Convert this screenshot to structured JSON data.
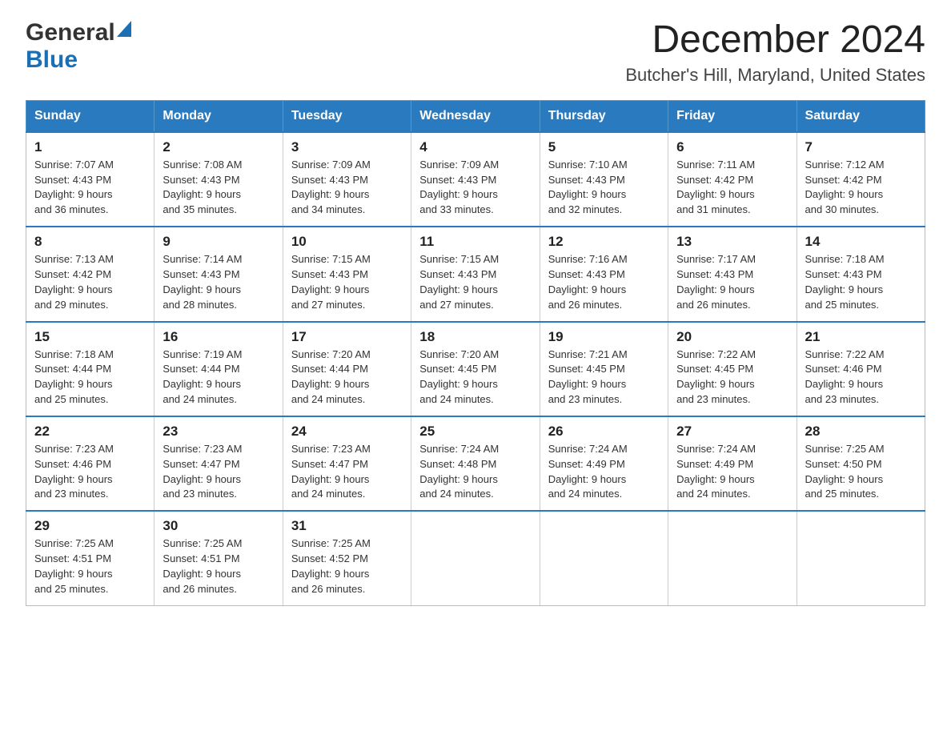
{
  "logo": {
    "general": "General",
    "blue": "Blue"
  },
  "header": {
    "title": "December 2024",
    "subtitle": "Butcher's Hill, Maryland, United States"
  },
  "calendar": {
    "days_of_week": [
      "Sunday",
      "Monday",
      "Tuesday",
      "Wednesday",
      "Thursday",
      "Friday",
      "Saturday"
    ],
    "weeks": [
      [
        {
          "day": "1",
          "sunrise": "7:07 AM",
          "sunset": "4:43 PM",
          "daylight": "9 hours and 36 minutes."
        },
        {
          "day": "2",
          "sunrise": "7:08 AM",
          "sunset": "4:43 PM",
          "daylight": "9 hours and 35 minutes."
        },
        {
          "day": "3",
          "sunrise": "7:09 AM",
          "sunset": "4:43 PM",
          "daylight": "9 hours and 34 minutes."
        },
        {
          "day": "4",
          "sunrise": "7:09 AM",
          "sunset": "4:43 PM",
          "daylight": "9 hours and 33 minutes."
        },
        {
          "day": "5",
          "sunrise": "7:10 AM",
          "sunset": "4:43 PM",
          "daylight": "9 hours and 32 minutes."
        },
        {
          "day": "6",
          "sunrise": "7:11 AM",
          "sunset": "4:42 PM",
          "daylight": "9 hours and 31 minutes."
        },
        {
          "day": "7",
          "sunrise": "7:12 AM",
          "sunset": "4:42 PM",
          "daylight": "9 hours and 30 minutes."
        }
      ],
      [
        {
          "day": "8",
          "sunrise": "7:13 AM",
          "sunset": "4:42 PM",
          "daylight": "9 hours and 29 minutes."
        },
        {
          "day": "9",
          "sunrise": "7:14 AM",
          "sunset": "4:43 PM",
          "daylight": "9 hours and 28 minutes."
        },
        {
          "day": "10",
          "sunrise": "7:15 AM",
          "sunset": "4:43 PM",
          "daylight": "9 hours and 27 minutes."
        },
        {
          "day": "11",
          "sunrise": "7:15 AM",
          "sunset": "4:43 PM",
          "daylight": "9 hours and 27 minutes."
        },
        {
          "day": "12",
          "sunrise": "7:16 AM",
          "sunset": "4:43 PM",
          "daylight": "9 hours and 26 minutes."
        },
        {
          "day": "13",
          "sunrise": "7:17 AM",
          "sunset": "4:43 PM",
          "daylight": "9 hours and 26 minutes."
        },
        {
          "day": "14",
          "sunrise": "7:18 AM",
          "sunset": "4:43 PM",
          "daylight": "9 hours and 25 minutes."
        }
      ],
      [
        {
          "day": "15",
          "sunrise": "7:18 AM",
          "sunset": "4:44 PM",
          "daylight": "9 hours and 25 minutes."
        },
        {
          "day": "16",
          "sunrise": "7:19 AM",
          "sunset": "4:44 PM",
          "daylight": "9 hours and 24 minutes."
        },
        {
          "day": "17",
          "sunrise": "7:20 AM",
          "sunset": "4:44 PM",
          "daylight": "9 hours and 24 minutes."
        },
        {
          "day": "18",
          "sunrise": "7:20 AM",
          "sunset": "4:45 PM",
          "daylight": "9 hours and 24 minutes."
        },
        {
          "day": "19",
          "sunrise": "7:21 AM",
          "sunset": "4:45 PM",
          "daylight": "9 hours and 23 minutes."
        },
        {
          "day": "20",
          "sunrise": "7:22 AM",
          "sunset": "4:45 PM",
          "daylight": "9 hours and 23 minutes."
        },
        {
          "day": "21",
          "sunrise": "7:22 AM",
          "sunset": "4:46 PM",
          "daylight": "9 hours and 23 minutes."
        }
      ],
      [
        {
          "day": "22",
          "sunrise": "7:23 AM",
          "sunset": "4:46 PM",
          "daylight": "9 hours and 23 minutes."
        },
        {
          "day": "23",
          "sunrise": "7:23 AM",
          "sunset": "4:47 PM",
          "daylight": "9 hours and 23 minutes."
        },
        {
          "day": "24",
          "sunrise": "7:23 AM",
          "sunset": "4:47 PM",
          "daylight": "9 hours and 24 minutes."
        },
        {
          "day": "25",
          "sunrise": "7:24 AM",
          "sunset": "4:48 PM",
          "daylight": "9 hours and 24 minutes."
        },
        {
          "day": "26",
          "sunrise": "7:24 AM",
          "sunset": "4:49 PM",
          "daylight": "9 hours and 24 minutes."
        },
        {
          "day": "27",
          "sunrise": "7:24 AM",
          "sunset": "4:49 PM",
          "daylight": "9 hours and 24 minutes."
        },
        {
          "day": "28",
          "sunrise": "7:25 AM",
          "sunset": "4:50 PM",
          "daylight": "9 hours and 25 minutes."
        }
      ],
      [
        {
          "day": "29",
          "sunrise": "7:25 AM",
          "sunset": "4:51 PM",
          "daylight": "9 hours and 25 minutes."
        },
        {
          "day": "30",
          "sunrise": "7:25 AM",
          "sunset": "4:51 PM",
          "daylight": "9 hours and 26 minutes."
        },
        {
          "day": "31",
          "sunrise": "7:25 AM",
          "sunset": "4:52 PM",
          "daylight": "9 hours and 26 minutes."
        },
        null,
        null,
        null,
        null
      ]
    ],
    "labels": {
      "sunrise": "Sunrise:",
      "sunset": "Sunset:",
      "daylight": "Daylight:"
    }
  }
}
